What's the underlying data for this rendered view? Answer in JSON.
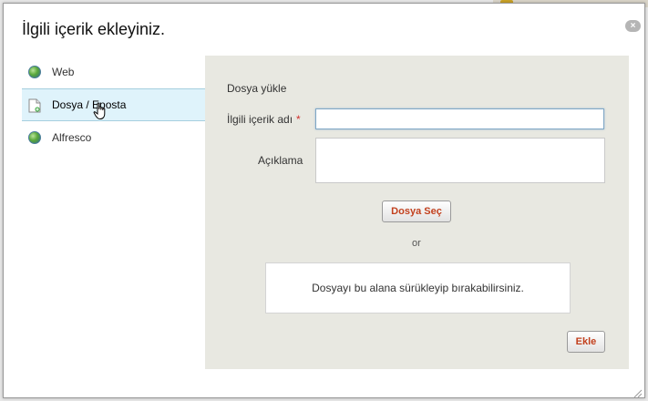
{
  "dialog": {
    "title": "İlgili içerik ekleyiniz.",
    "close_label": "×"
  },
  "sidebar": {
    "items": [
      {
        "label": "Web",
        "icon": "globe-icon",
        "active": false
      },
      {
        "label": "Dosya / Eposta",
        "icon": "document-icon",
        "active": true
      },
      {
        "label": "Alfresco",
        "icon": "globe-icon",
        "active": false
      }
    ]
  },
  "form": {
    "section_title": "Dosya yükle",
    "related_label": "İlgili içerik adı",
    "required_mark": "*",
    "related_value": "",
    "description_label": "Açıklama",
    "description_value": "",
    "choose_file_label": "Dosya Seç",
    "or_text": "or",
    "dropzone_text": "Dosyayı bu alana sürükleyip bırakabilirsiniz.",
    "add_label": "Ekle"
  },
  "colors": {
    "panel_bg": "#e8e8e1",
    "active_item_bg": "#dff3fb",
    "button_text": "#c2401e",
    "required": "#d0312d"
  }
}
